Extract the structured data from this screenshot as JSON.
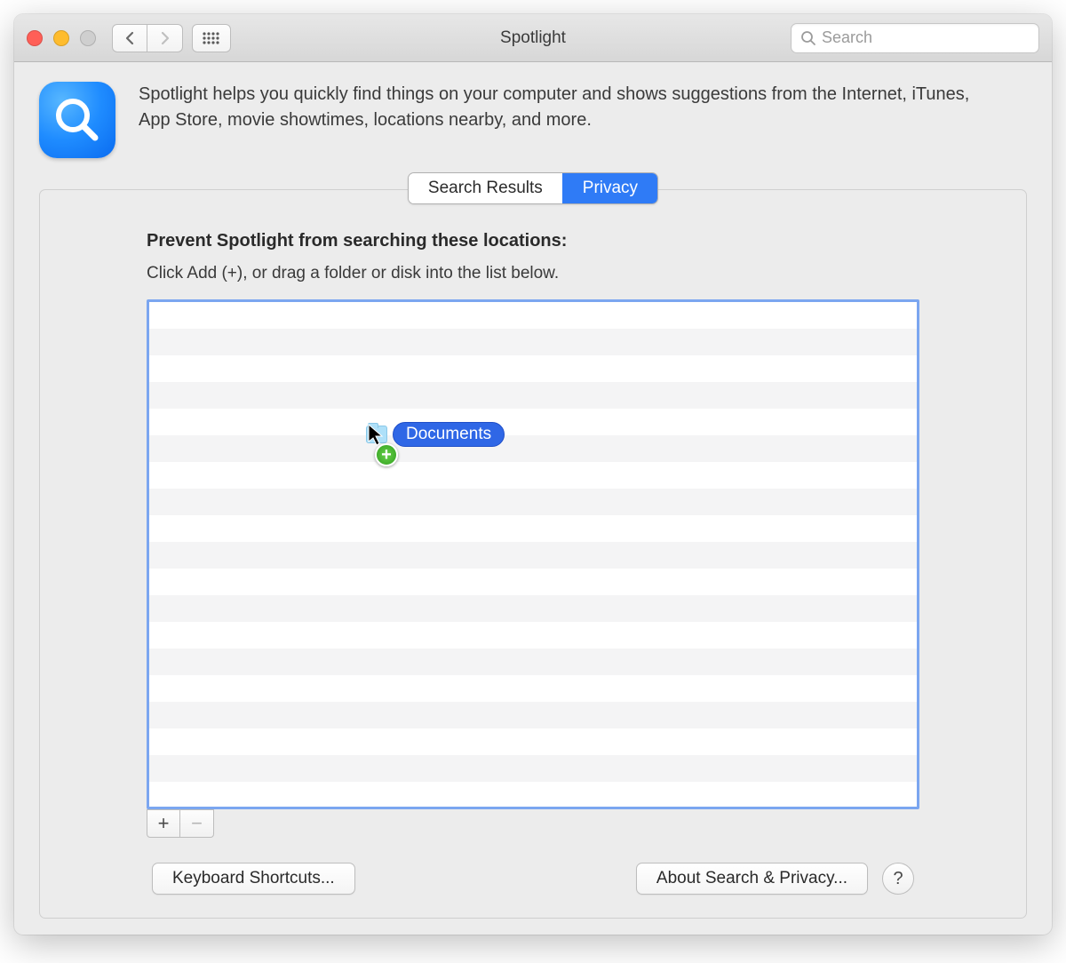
{
  "titlebar": {
    "title": "Spotlight",
    "search_placeholder": "Search"
  },
  "intro": {
    "text": "Spotlight helps you quickly find things on your computer and shows suggestions from the Internet, iTunes, App Store, movie showtimes, locations nearby, and more."
  },
  "tabs": {
    "search_results": "Search Results",
    "privacy": "Privacy",
    "active": "privacy"
  },
  "privacy": {
    "heading": "Prevent Spotlight from searching these locations:",
    "subheading": "Click Add (+), or drag a folder or disk into the list below.",
    "drag_item_label": "Documents"
  },
  "buttons": {
    "add": "+",
    "remove": "−",
    "keyboard_shortcuts": "Keyboard Shortcuts...",
    "about_privacy": "About Search & Privacy...",
    "help": "?"
  }
}
